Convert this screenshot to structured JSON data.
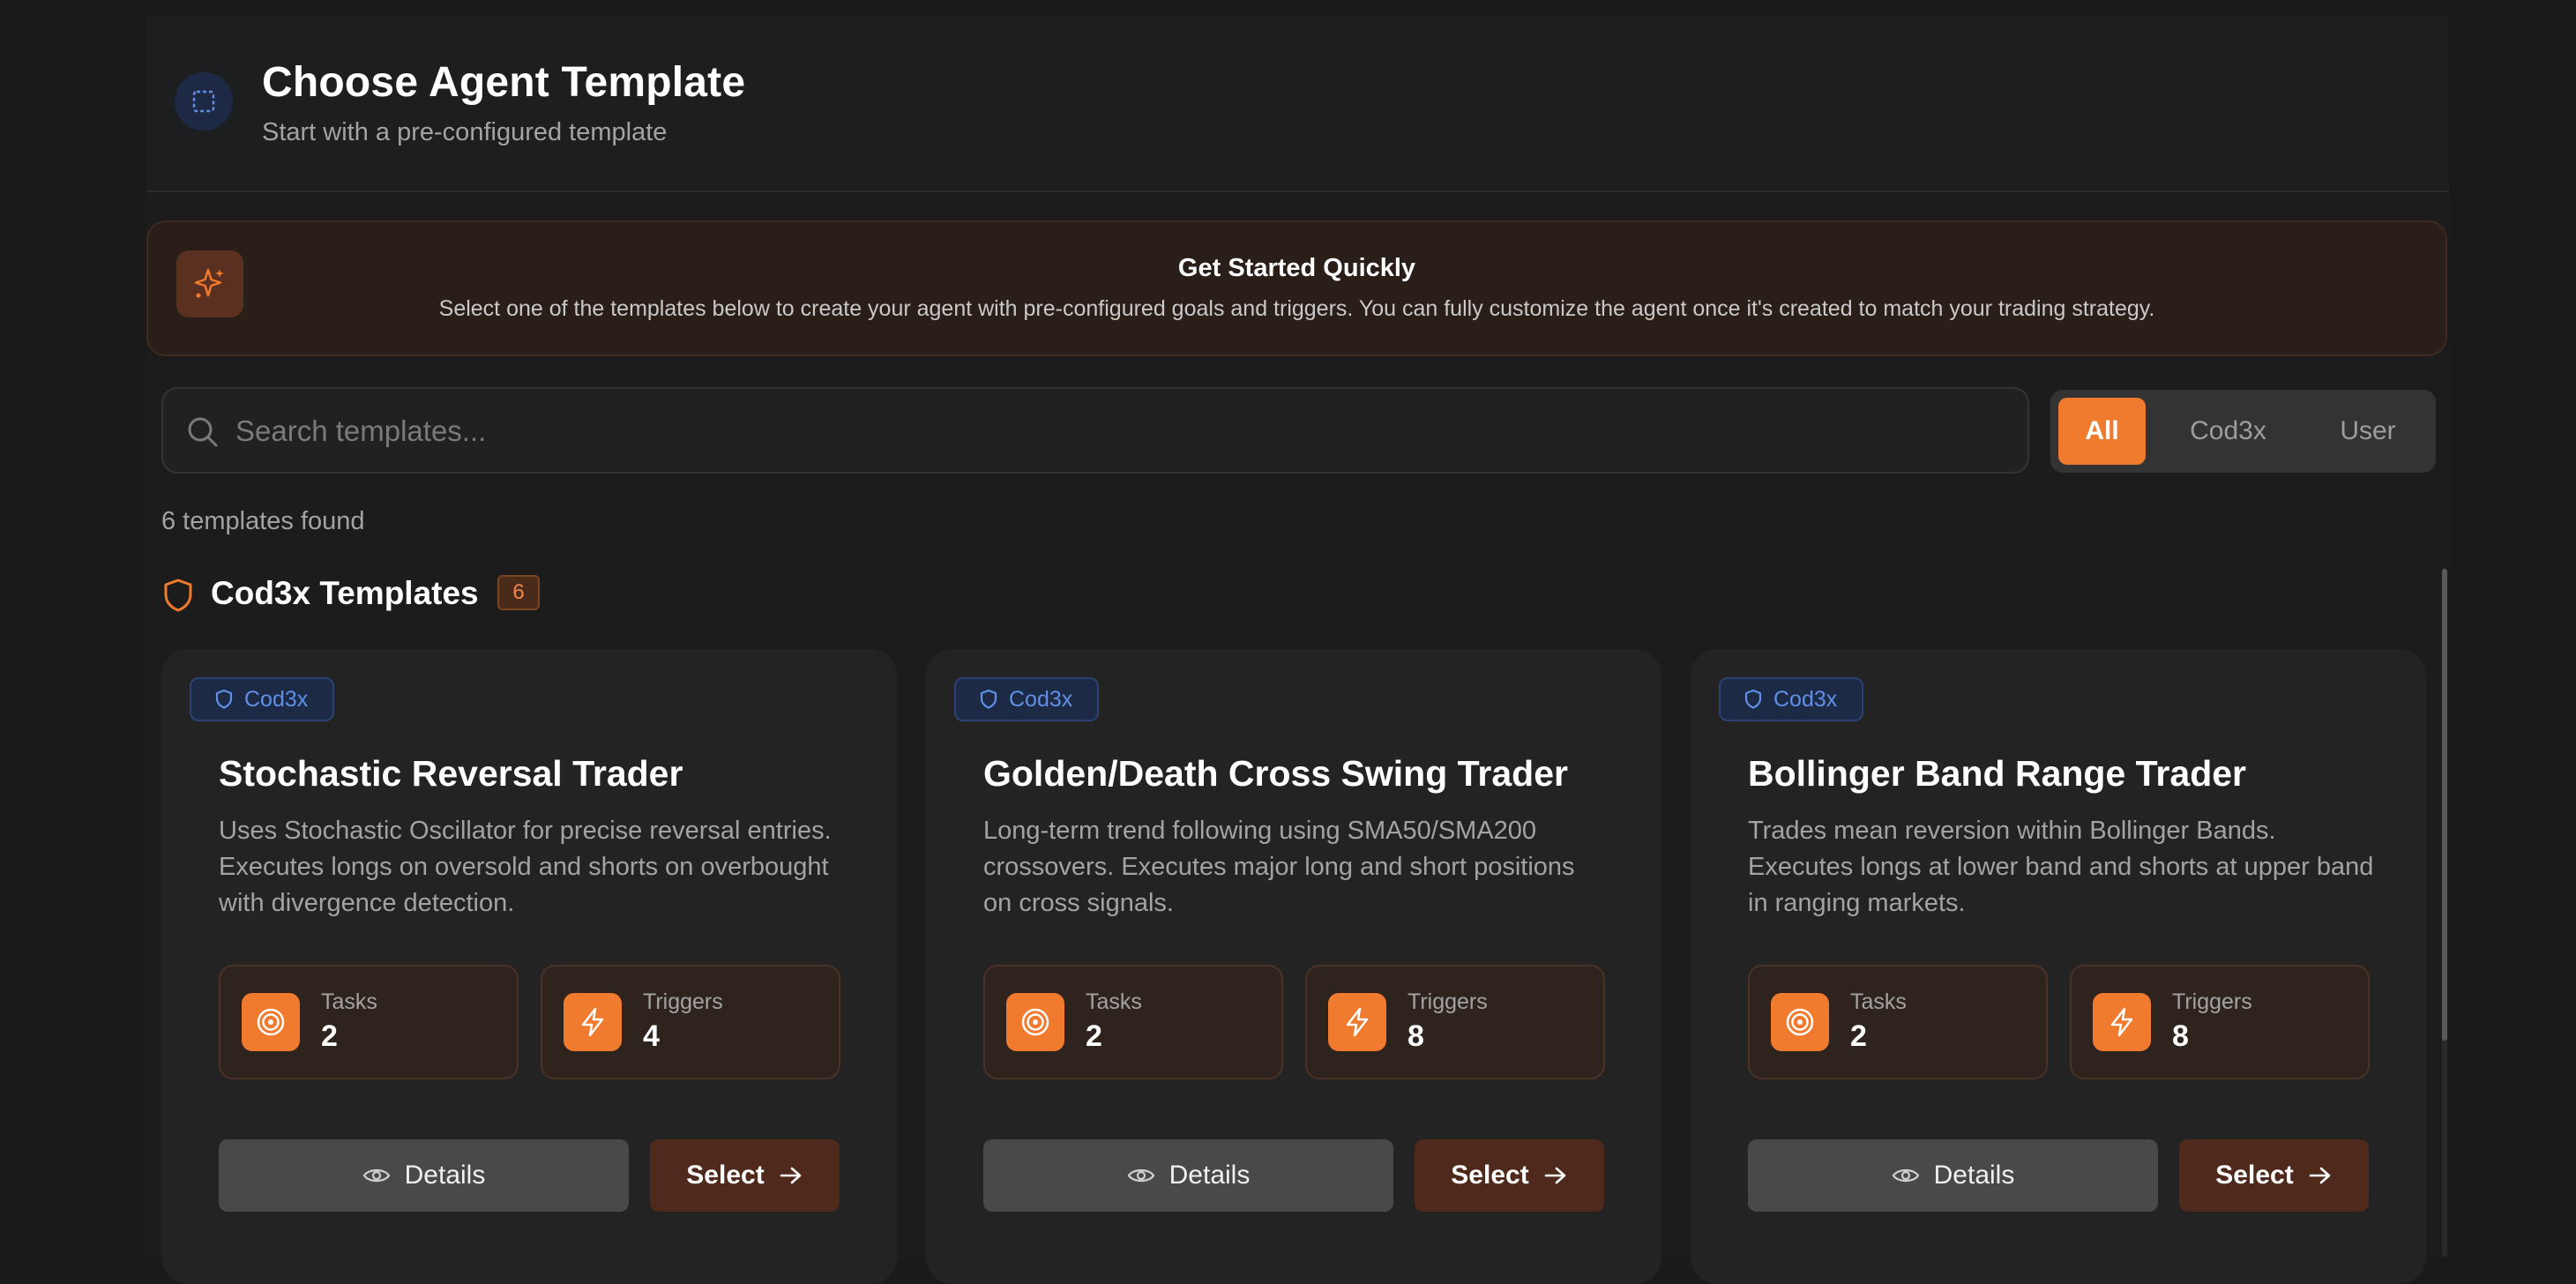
{
  "header": {
    "title": "Choose Agent Template",
    "subtitle": "Start with a pre-configured template",
    "icon": "template-selection-icon"
  },
  "banner": {
    "icon": "sparkles-icon",
    "title": "Get Started Quickly",
    "text": "Select one of the templates below to create your agent with pre-configured goals and triggers. You can fully customize the agent once it's created to match your trading strategy."
  },
  "search": {
    "placeholder": "Search templates...",
    "value": ""
  },
  "filters": [
    {
      "label": "All",
      "active": true
    },
    {
      "label": "Cod3x",
      "active": false
    },
    {
      "label": "User",
      "active": false
    }
  ],
  "results": {
    "count_text": "6 templates found"
  },
  "section": {
    "title": "Cod3x Templates",
    "count": "6",
    "icon": "shield-icon"
  },
  "cards": [
    {
      "badge": "Cod3x",
      "title": "Stochastic Reversal Trader",
      "description": "Uses Stochastic Oscillator for precise reversal entries. Executes longs on oversold and shorts on overbought with divergence detection.",
      "tasks_label": "Tasks",
      "tasks_value": "2",
      "triggers_label": "Triggers",
      "triggers_value": "4",
      "details_label": "Details",
      "select_label": "Select"
    },
    {
      "badge": "Cod3x",
      "title": "Golden/Death Cross Swing Trader",
      "description": "Long-term trend following using SMA50/SMA200 crossovers. Executes major long and short positions on cross signals.",
      "tasks_label": "Tasks",
      "tasks_value": "2",
      "triggers_label": "Triggers",
      "triggers_value": "8",
      "details_label": "Details",
      "select_label": "Select"
    },
    {
      "badge": "Cod3x",
      "title": "Bollinger Band Range Trader",
      "description": "Trades mean reversion within Bollinger Bands. Executes longs at lower band and shorts at upper band in ranging markets.",
      "tasks_label": "Tasks",
      "tasks_value": "2",
      "triggers_label": "Triggers",
      "triggers_value": "8",
      "details_label": "Details",
      "select_label": "Select"
    }
  ],
  "colors": {
    "accent": "#f07a2e",
    "badge_blue": "#5f8fe6",
    "background": "#1a1a1a"
  }
}
